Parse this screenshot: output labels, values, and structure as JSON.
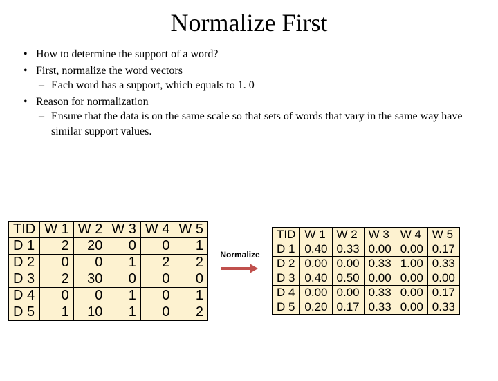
{
  "title": "Normalize First",
  "bullets": {
    "b1": "How to determine the support of a word?",
    "b2": "First, normalize the word vectors",
    "b2a": "Each word has a support, which equals to 1. 0",
    "b3": "Reason for normalization",
    "b3a": "Ensure that the data is on the same scale so that sets of words that vary in the same way have similar support values."
  },
  "arrow_label": "Normalize",
  "left": {
    "headers": [
      "TID",
      "W 1",
      "W 2",
      "W 3",
      "W 4",
      "W 5"
    ],
    "rows": [
      {
        "tid": "D 1",
        "w1": "2",
        "w2": "20",
        "w3": "0",
        "w4": "0",
        "w5": "1"
      },
      {
        "tid": "D 2",
        "w1": "0",
        "w2": "0",
        "w3": "1",
        "w4": "2",
        "w5": "2"
      },
      {
        "tid": "D 3",
        "w1": "2",
        "w2": "30",
        "w3": "0",
        "w4": "0",
        "w5": "0"
      },
      {
        "tid": "D 4",
        "w1": "0",
        "w2": "0",
        "w3": "1",
        "w4": "0",
        "w5": "1"
      },
      {
        "tid": "D 5",
        "w1": "1",
        "w2": "10",
        "w3": "1",
        "w4": "0",
        "w5": "2"
      }
    ]
  },
  "right": {
    "headers": [
      "TID",
      "W 1",
      "W 2",
      "W 3",
      "W 4",
      "W 5"
    ],
    "rows": [
      {
        "tid": "D 1",
        "w1": "0.40",
        "w2": "0.33",
        "w3": "0.00",
        "w4": "0.00",
        "w5": "0.17"
      },
      {
        "tid": "D 2",
        "w1": "0.00",
        "w2": "0.00",
        "w3": "0.33",
        "w4": "1.00",
        "w5": "0.33"
      },
      {
        "tid": "D 3",
        "w1": "0.40",
        "w2": "0.50",
        "w3": "0.00",
        "w4": "0.00",
        "w5": "0.00"
      },
      {
        "tid": "D 4",
        "w1": "0.00",
        "w2": "0.00",
        "w3": "0.33",
        "w4": "0.00",
        "w5": "0.17"
      },
      {
        "tid": "D 5",
        "w1": "0.20",
        "w2": "0.17",
        "w3": "0.33",
        "w4": "0.00",
        "w5": "0.33"
      }
    ]
  }
}
